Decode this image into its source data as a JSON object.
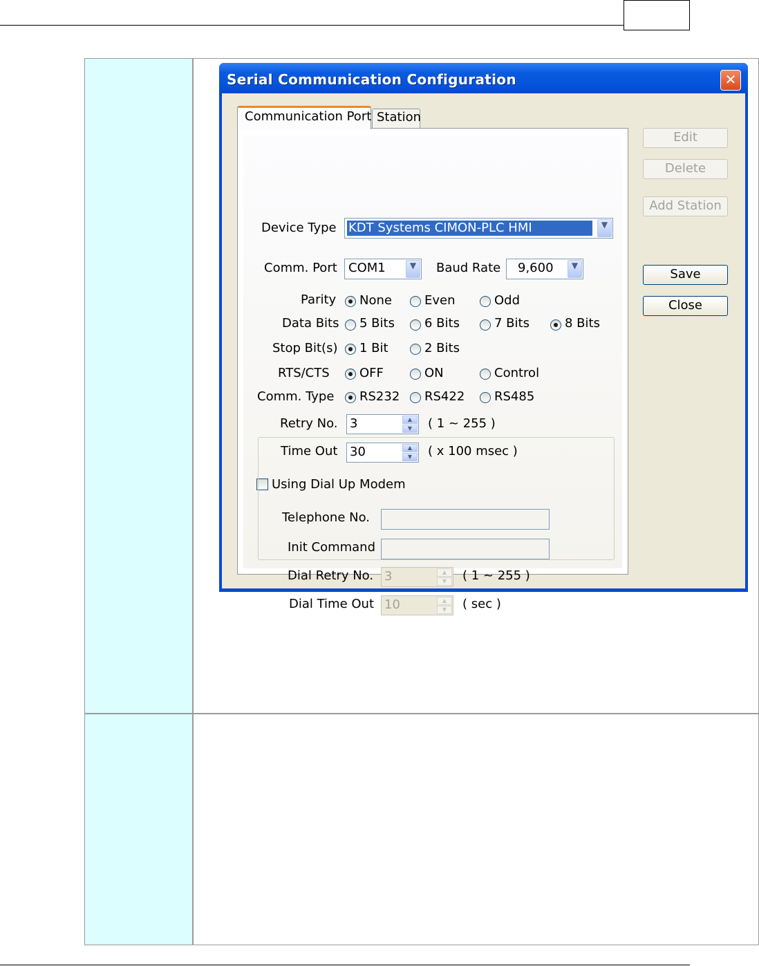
{
  "page": {
    "header_box_text": "",
    "table_rows": 2
  },
  "dialog": {
    "title": "Serial Communication Configuration",
    "close_glyph": "✕",
    "tabs": [
      {
        "label": "Communication Port"
      },
      {
        "label": "Station"
      }
    ],
    "device_type": {
      "label": "Device Type",
      "value": "KDT Systems CIMON-PLC HMI"
    },
    "comm_port": {
      "label": "Comm. Port",
      "value": "COM1"
    },
    "baud_rate": {
      "label": "Baud Rate",
      "value": "9,600"
    },
    "parity": {
      "label": "Parity",
      "options": [
        "None",
        "Even",
        "Odd"
      ],
      "selected": "None"
    },
    "data_bits": {
      "label": "Data Bits",
      "options": [
        "5 Bits",
        "6 Bits",
        "7 Bits",
        "8 Bits"
      ],
      "selected": "8 Bits"
    },
    "stop_bits": {
      "label": "Stop Bit(s)",
      "options": [
        "1 Bit",
        "2 Bits"
      ],
      "selected": "1 Bit"
    },
    "rts_cts": {
      "label": "RTS/CTS",
      "options": [
        "OFF",
        "ON",
        "Control"
      ],
      "selected": "OFF"
    },
    "comm_type": {
      "label": "Comm. Type",
      "options": [
        "RS232",
        "RS422",
        "RS485"
      ],
      "selected": "RS232"
    },
    "retry_no": {
      "label": "Retry No.",
      "value": "3",
      "hint": "( 1 ~ 255 )"
    },
    "time_out": {
      "label": "Time Out",
      "value": "30",
      "hint": "( x 100 msec )"
    },
    "dial_up": {
      "label": "Using Dial Up Modem",
      "checked": false
    },
    "telephone_no": {
      "label": "Telephone No.",
      "value": ""
    },
    "init_command": {
      "label": "Init Command",
      "value": ""
    },
    "dial_retry_no": {
      "label": "Dial Retry No.",
      "value": "3",
      "hint": "( 1 ~ 255 )"
    },
    "dial_time_out": {
      "label": "Dial Time Out",
      "value": "10",
      "hint": "( sec )"
    },
    "buttons": {
      "edit": "Edit",
      "delete": "Delete",
      "add_station": "Add Station",
      "save": "Save",
      "close": "Close"
    }
  },
  "colors": {
    "cell_left": "#dcfefe",
    "title_bar": "#0a5ae0",
    "dialog_face": "#ece9d8",
    "selection": "#316ac5"
  }
}
